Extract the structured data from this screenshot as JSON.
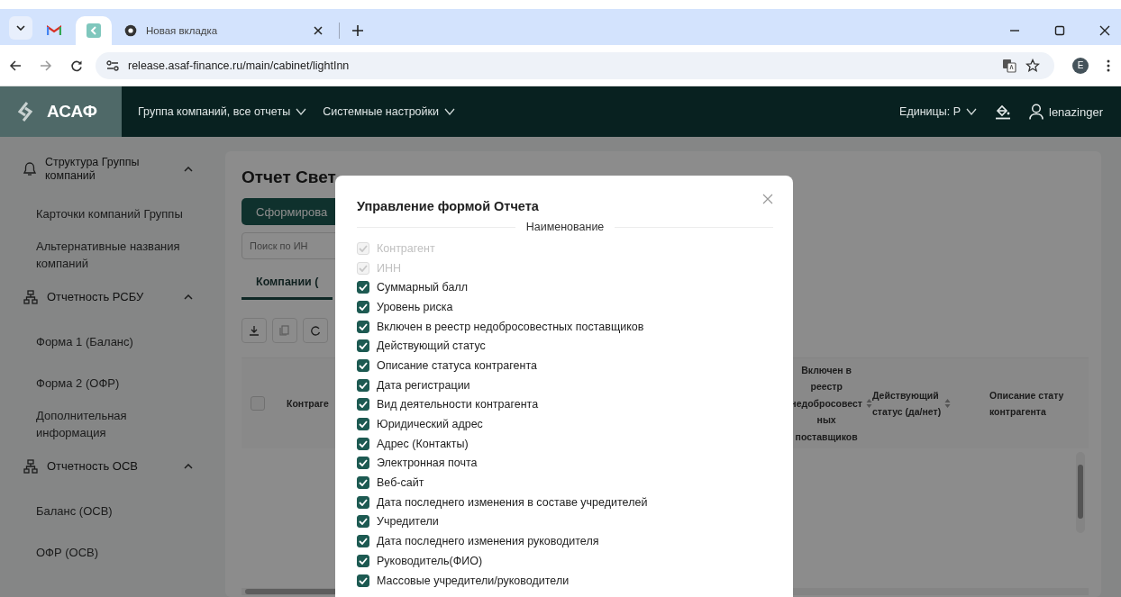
{
  "browser": {
    "tabs": [
      {
        "kind": "mail",
        "selected": false
      },
      {
        "kind": "app",
        "selected": true
      },
      {
        "kind": "newtab",
        "label": "Новая вкладка",
        "selected": false
      }
    ],
    "url": "release.asaf-finance.ru/main/cabinet/lightInn",
    "profile_initial": "E"
  },
  "header": {
    "logo": "АСАФ",
    "nav": [
      "Группа компаний, все отчеты",
      "Системные настройки"
    ],
    "units": "Единицы: Р",
    "user": "lenazinger"
  },
  "sidebar": [
    {
      "label": "Структура Группы компаний",
      "expanded": true,
      "children": [
        {
          "label": "Карточки компаний Группы"
        },
        {
          "label": "Альтернативные названия компаний"
        }
      ]
    },
    {
      "label": "Отчетность РСБУ",
      "expanded": true,
      "children": [
        {
          "label": "Форма 1 (Баланс)"
        },
        {
          "label": "Форма 2 (ОФР)"
        },
        {
          "label": "Дополнительная информация"
        }
      ]
    },
    {
      "label": "Отчетность ОСВ",
      "expanded": true,
      "children": [
        {
          "label": "Баланс (ОСВ)"
        },
        {
          "label": "ОФР (ОСВ)"
        }
      ]
    }
  ],
  "main": {
    "title": "Отчет Свет",
    "generate_button": "Сформирова",
    "search": {
      "placeholder": "Поиск по ИН"
    },
    "tabs": [
      {
        "label": "Компании (",
        "selected": true
      }
    ],
    "table": {
      "select_all_checked": false,
      "columns": [
        {
          "lines": [
            "Контраге"
          ],
          "sortable": false
        },
        {
          "lines": [
            "Включен в",
            "реестр",
            "недобросовест",
            "ных",
            "поставщиков"
          ],
          "sortable": true
        },
        {
          "lines": [
            "Действующий",
            "статус (да/нет)"
          ],
          "sortable": true
        },
        {
          "lines": [
            "Описание стату",
            "контрагента"
          ],
          "sortable": false
        }
      ]
    }
  },
  "modal": {
    "title": "Управление формой Отчета",
    "section": "Наименование",
    "options": [
      {
        "label": "Контрагент",
        "checked": true,
        "disabled": true
      },
      {
        "label": "ИНН",
        "checked": true,
        "disabled": true
      },
      {
        "label": "Суммарный балл",
        "checked": true,
        "disabled": false
      },
      {
        "label": "Уровень риска",
        "checked": true,
        "disabled": false
      },
      {
        "label": "Включен в реестр недобросовестных поставщиков",
        "checked": true,
        "disabled": false
      },
      {
        "label": "Действующий статус",
        "checked": true,
        "disabled": false
      },
      {
        "label": "Описание статуса контрагента",
        "checked": true,
        "disabled": false
      },
      {
        "label": "Дата регистрации",
        "checked": true,
        "disabled": false
      },
      {
        "label": "Вид деятельности контрагента",
        "checked": true,
        "disabled": false
      },
      {
        "label": "Юридический адрес",
        "checked": true,
        "disabled": false
      },
      {
        "label": "Адрес (Контакты)",
        "checked": true,
        "disabled": false
      },
      {
        "label": "Электронная почта",
        "checked": true,
        "disabled": false
      },
      {
        "label": "Веб-сайт",
        "checked": true,
        "disabled": false
      },
      {
        "label": "Дата последнего изменения в составе учредителей",
        "checked": true,
        "disabled": false
      },
      {
        "label": "Учредители",
        "checked": true,
        "disabled": false
      },
      {
        "label": "Дата последнего изменения руководителя",
        "checked": true,
        "disabled": false
      },
      {
        "label": "Руководитель(ФИО)",
        "checked": true,
        "disabled": false
      },
      {
        "label": "Массовые учредители/руководители",
        "checked": true,
        "disabled": false
      }
    ]
  }
}
